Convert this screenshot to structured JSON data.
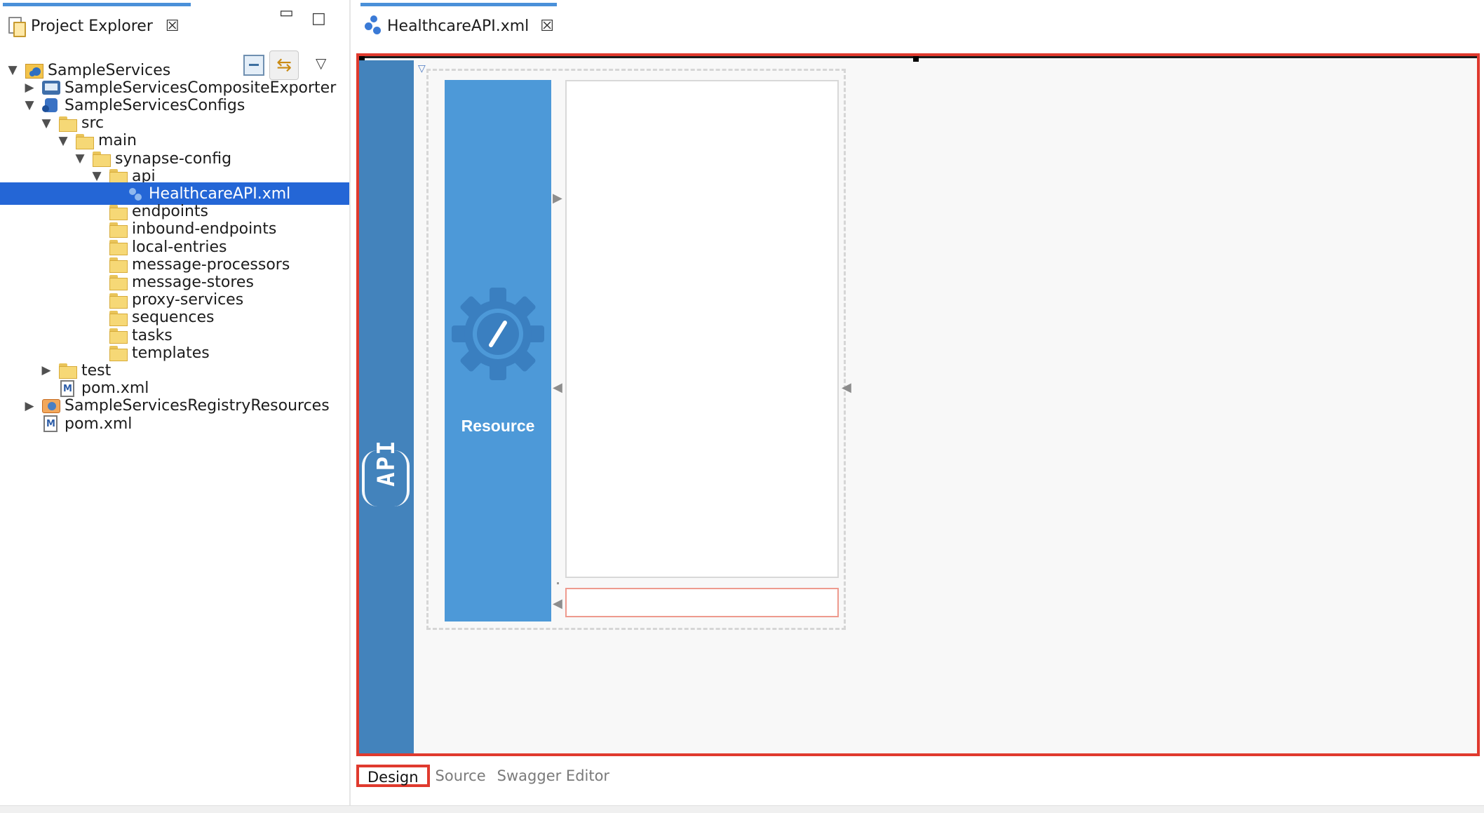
{
  "explorer": {
    "title": "Project Explorer",
    "close_symbol": "☒",
    "minimize_symbol": "▭",
    "maximize_symbol": "□",
    "menu_symbol": "▽",
    "link_symbol": "⇆",
    "tree": [
      {
        "label": "SampleServices",
        "level": 0,
        "twisty": "▼",
        "icon": "project-icon"
      },
      {
        "label": "SampleServicesCompositeExporter",
        "level": 1,
        "twisty": "▶",
        "icon": "exporter-icon"
      },
      {
        "label": "SampleServicesConfigs",
        "level": 1,
        "twisty": "▼",
        "icon": "configs-icon"
      },
      {
        "label": "src",
        "level": 2,
        "twisty": "▼",
        "icon": "folder-icon"
      },
      {
        "label": "main",
        "level": 3,
        "twisty": "▼",
        "icon": "folder-icon"
      },
      {
        "label": "synapse-config",
        "level": 4,
        "twisty": "▼",
        "icon": "folder-icon"
      },
      {
        "label": "api",
        "level": 5,
        "twisty": "▼",
        "icon": "folder-icon"
      },
      {
        "label": "HealthcareAPI.xml",
        "level": 6,
        "twisty": "",
        "icon": "api-file-icon",
        "selected": true
      },
      {
        "label": "endpoints",
        "level": 5,
        "twisty": "",
        "icon": "folder-icon"
      },
      {
        "label": "inbound-endpoints",
        "level": 5,
        "twisty": "",
        "icon": "folder-icon"
      },
      {
        "label": "local-entries",
        "level": 5,
        "twisty": "",
        "icon": "folder-icon"
      },
      {
        "label": "message-processors",
        "level": 5,
        "twisty": "",
        "icon": "folder-icon"
      },
      {
        "label": "message-stores",
        "level": 5,
        "twisty": "",
        "icon": "folder-icon"
      },
      {
        "label": "proxy-services",
        "level": 5,
        "twisty": "",
        "icon": "folder-icon"
      },
      {
        "label": "sequences",
        "level": 5,
        "twisty": "",
        "icon": "folder-icon"
      },
      {
        "label": "tasks",
        "level": 5,
        "twisty": "",
        "icon": "folder-icon"
      },
      {
        "label": "templates",
        "level": 5,
        "twisty": "",
        "icon": "folder-icon"
      },
      {
        "label": "test",
        "level": 2,
        "twisty": "▶",
        "icon": "folder-icon"
      },
      {
        "label": "pom.xml",
        "level": 2,
        "twisty": "",
        "icon": "pom-icon"
      },
      {
        "label": "SampleServicesRegistryResources",
        "level": 1,
        "twisty": "▶",
        "icon": "registry-icon"
      },
      {
        "label": "pom.xml",
        "level": 1,
        "twisty": "",
        "icon": "pom-icon"
      }
    ]
  },
  "editor": {
    "tab_title": "HealthcareAPI.xml",
    "close_symbol": "☒",
    "api_label": "API",
    "resource_label": "Resource",
    "arrow_symbol": "▶",
    "arrow_left_symbol": "◀",
    "caret_symbol": "▽",
    "page_tabs": [
      "Design",
      "Source",
      "Swagger Editor"
    ],
    "active_page_tab": "Design"
  },
  "colors": {
    "selection": "#2466d6",
    "highlight_border": "#e03a2e",
    "api_bar": "#4383bc",
    "resource": "#4d99d8",
    "gear": "#3a7fc0"
  }
}
